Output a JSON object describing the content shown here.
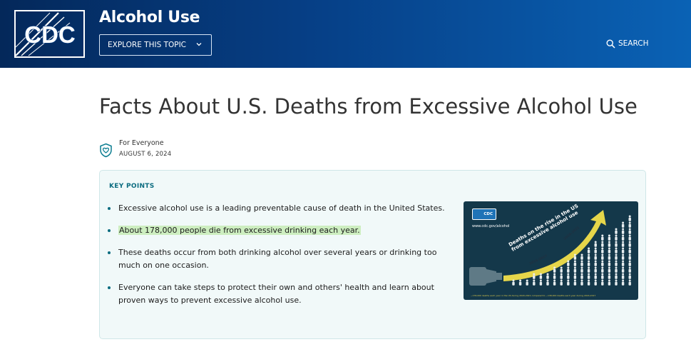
{
  "header": {
    "logo_text": "CDC",
    "topic_title": "Alcohol Use",
    "explore_label": "EXPLORE THIS TOPIC",
    "search_label": "SEARCH",
    "colors": {
      "gradient_start": "#04285a",
      "gradient_end": "#0a62b5"
    }
  },
  "article": {
    "title": "Facts About U.S. Deaths from Excessive Alcohol Use",
    "audience": "For Everyone",
    "audience_icon": "heart-shield-icon",
    "date": "AUGUST 6, 2024"
  },
  "key_points": {
    "heading": "KEY POINTS",
    "items": [
      {
        "text": "Excessive alcohol use is a leading preventable cause of death in the United States.",
        "highlighted": false
      },
      {
        "text": "About 178,000 people die from excessive drinking each year.",
        "highlighted": true
      },
      {
        "text": "These deaths occur from both drinking alcohol over several years or drinking too much on one occasion.",
        "highlighted": false
      },
      {
        "text": "Everyone can take steps to protect their own and others' health and learn about proven ways to prevent excessive alcohol use.",
        "highlighted": false
      }
    ],
    "colors": {
      "heading": "#0b6c80",
      "background": "#f1f9f9",
      "highlight": "#cdeec0"
    }
  },
  "infographic": {
    "badge_text": "CDC",
    "url": "www.cdc.gov/alcohol",
    "headline_line1": "Deaths on the rise in the US",
    "headline_line2": "from excessive alcohol use",
    "years_recent": "2020-2021",
    "years_earlier": "2016-2017",
    "footnote": "~178,000 deaths each year in the US during 2020-2021 compared to ~138,000 deaths each year during 2016-2017",
    "colors": {
      "background": "#14384a",
      "arrow": "#e6d64a",
      "figures": "#e8eef0"
    }
  }
}
